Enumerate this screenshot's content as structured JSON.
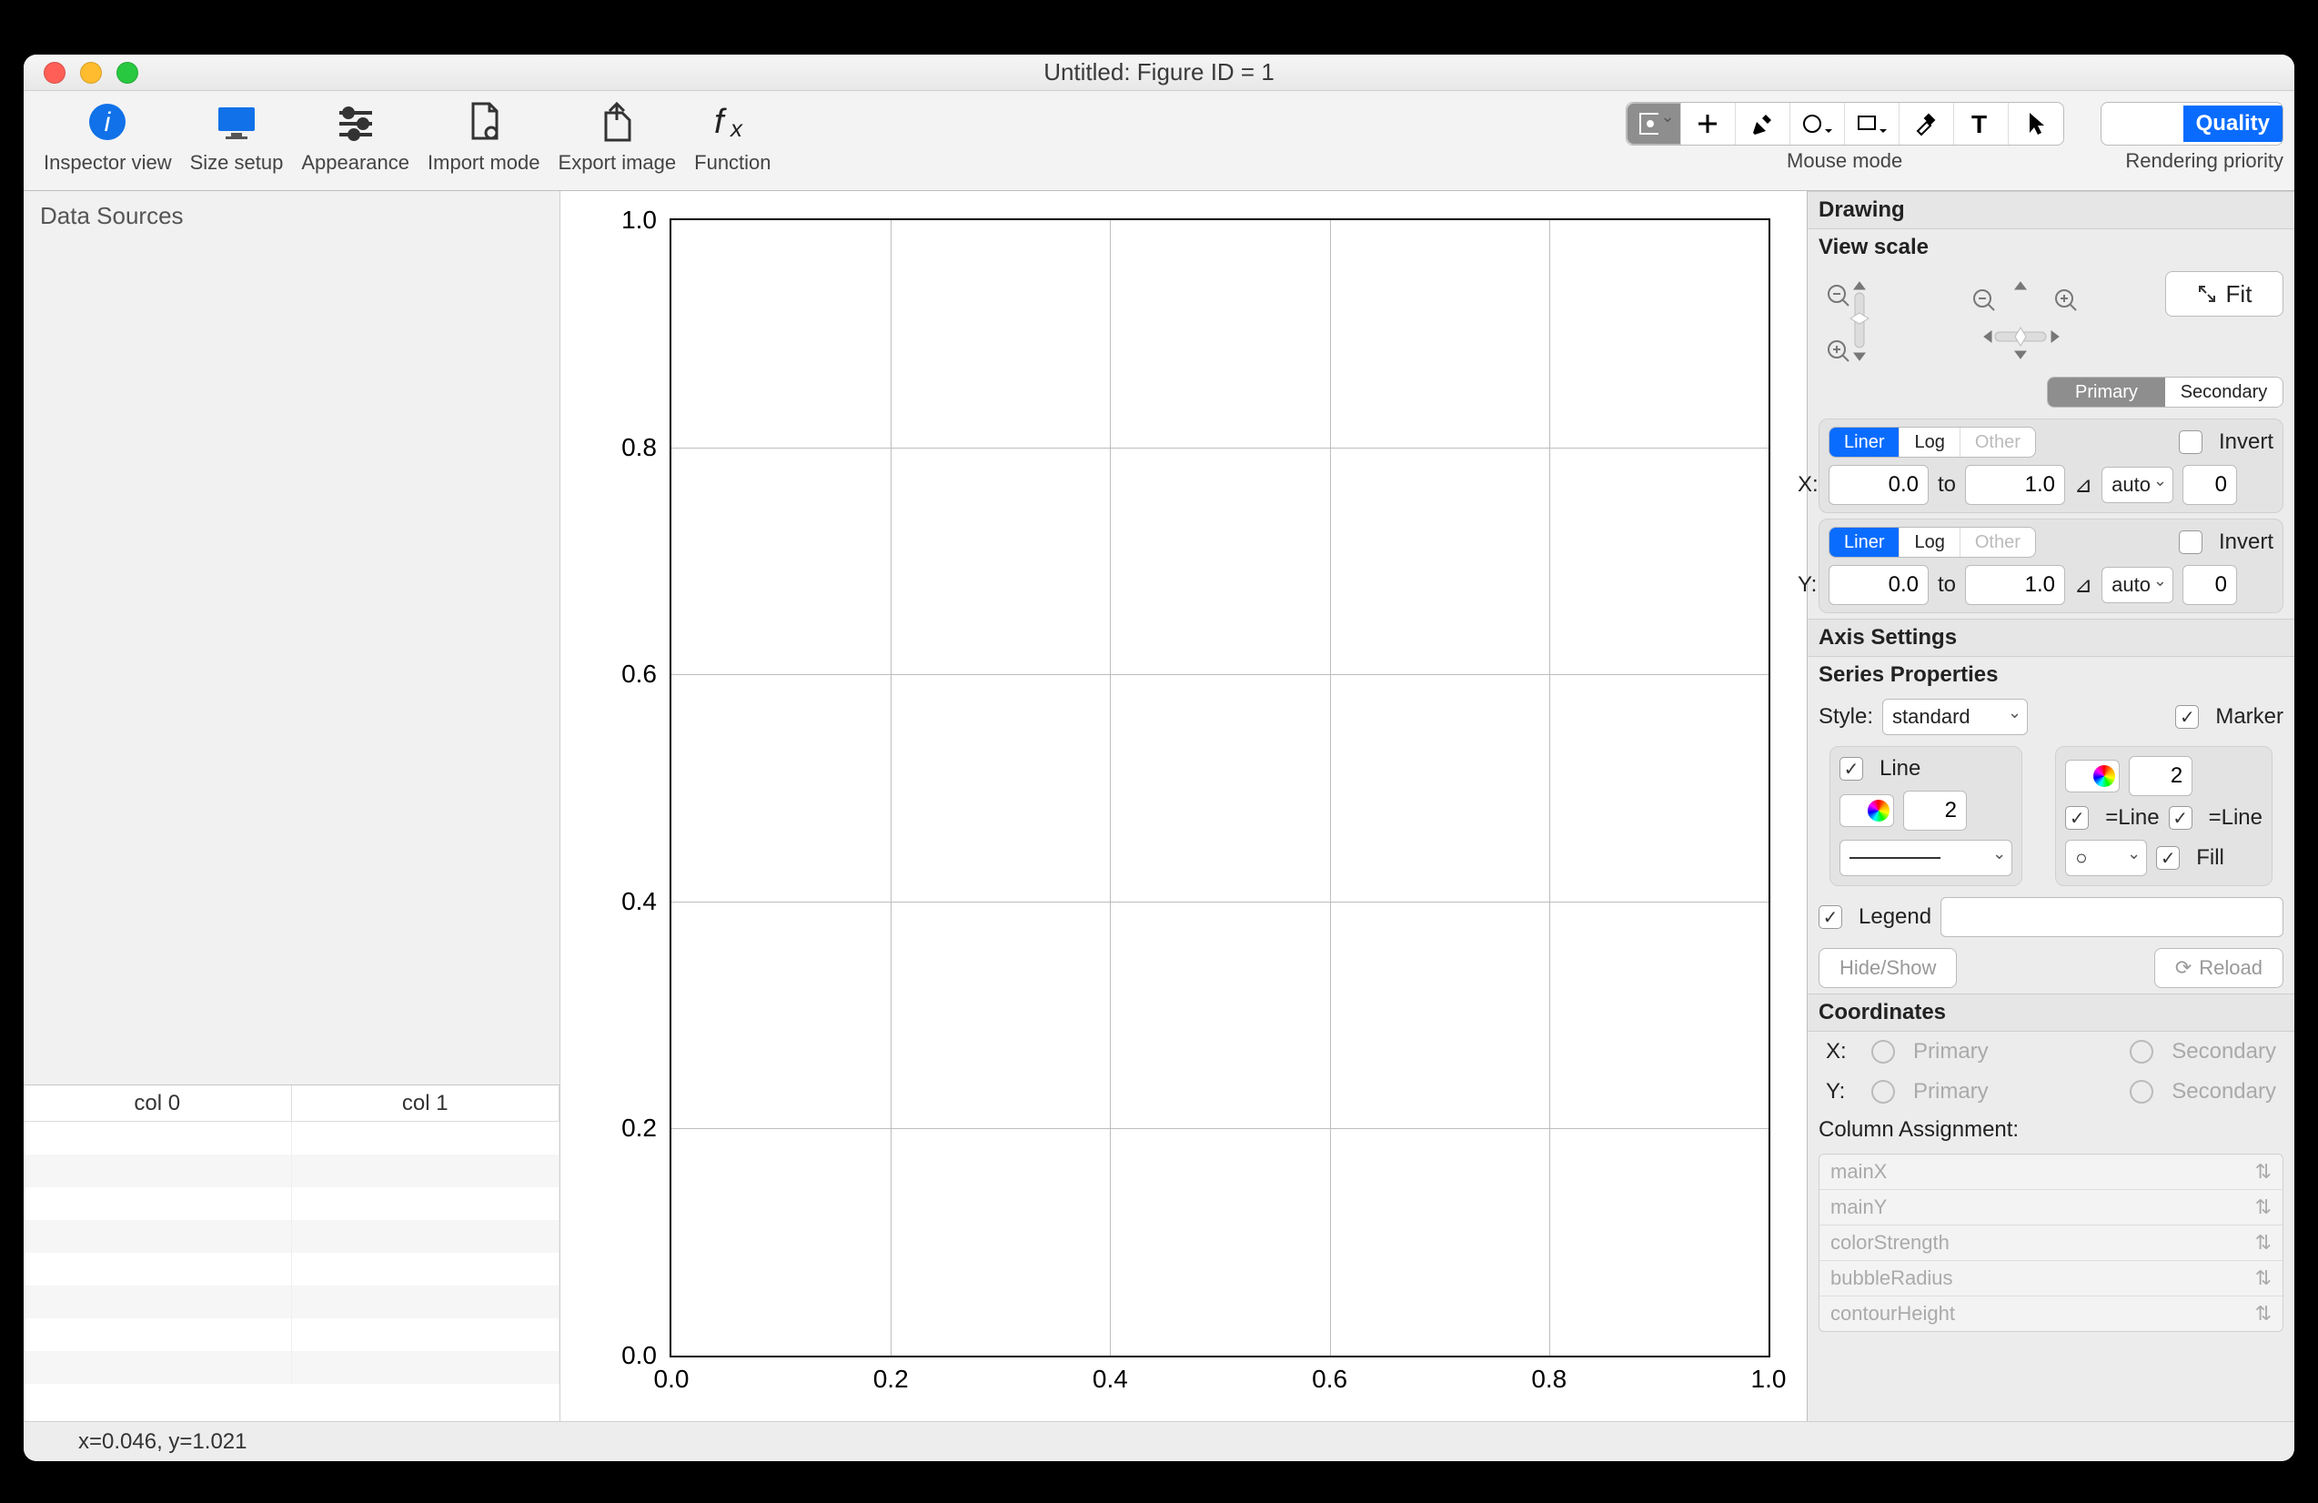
{
  "window": {
    "title": "Untitled: Figure ID = 1"
  },
  "toolbar": {
    "inspector": "Inspector view",
    "size": "Size setup",
    "appearance": "Appearance",
    "import": "Import mode",
    "export": "Export image",
    "function": "Function",
    "mouse_mode": "Mouse mode",
    "rendering": "Rendering priority",
    "quality": "Quality"
  },
  "left": {
    "header": "Data Sources",
    "cols": [
      "col 0",
      "col 1"
    ]
  },
  "chart_data": {
    "type": "scatter",
    "series": [],
    "xlim": [
      0.0,
      1.0
    ],
    "ylim": [
      0.0,
      1.0
    ],
    "xticks": [
      "0.0",
      "0.2",
      "0.4",
      "0.6",
      "0.8",
      "1.0"
    ],
    "yticks": [
      "0.0",
      "0.2",
      "0.4",
      "0.6",
      "0.8",
      "1.0"
    ],
    "title": "",
    "xlabel": "",
    "ylabel": ""
  },
  "status": {
    "text": "x=0.046, y=1.021"
  },
  "right": {
    "drawing": "Drawing",
    "view_scale": "View scale",
    "fit": "Fit",
    "primary": "Primary",
    "secondary": "Secondary",
    "x_label": "X:",
    "y_label": "Y:",
    "liner": "Liner",
    "log": "Log",
    "other": "Other",
    "invert": "Invert",
    "x_from": "0.0",
    "x_to_lbl": "to",
    "x_to": "1.0",
    "x_auto": "auto",
    "x_decimals": "0",
    "y_from": "0.0",
    "y_to": "1.0",
    "y_auto": "auto",
    "y_decimals": "0",
    "axis_settings": "Axis Settings",
    "series_props": "Series Properties",
    "style": "Style:",
    "style_val": "standard",
    "marker": "Marker",
    "line": "Line",
    "line_w": "2",
    "marker_sz": "2",
    "eq_line1": "=Line",
    "eq_line2": "=Line",
    "fill": "Fill",
    "legend": "Legend",
    "hide_show": "Hide/Show",
    "reload": "Reload",
    "coordinates": "Coordinates",
    "coord_primary": "Primary",
    "coord_secondary": "Secondary",
    "col_assign": "Column Assignment:",
    "ca": [
      "mainX",
      "mainY",
      "colorStrength",
      "bubbleRadius",
      "contourHeight"
    ]
  }
}
